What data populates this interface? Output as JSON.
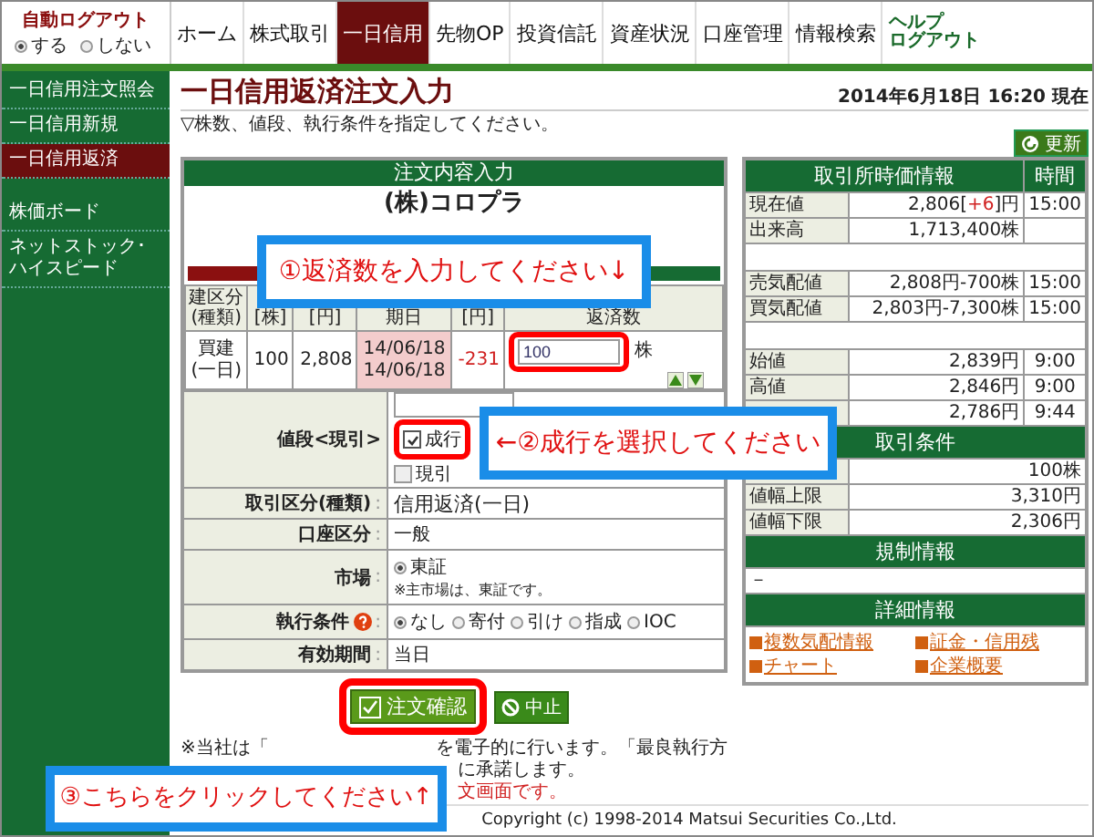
{
  "auto_logout": {
    "label": "自動ログアウト",
    "options": [
      {
        "label": "する",
        "selected": true
      },
      {
        "label": "しない",
        "selected": false
      }
    ]
  },
  "nav": [
    {
      "label": "ホーム",
      "selected": false
    },
    {
      "label": "株式取引",
      "selected": false
    },
    {
      "label": "一日信用",
      "selected": true
    },
    {
      "label": "先物OP",
      "selected": false
    },
    {
      "label": "投資信託",
      "selected": false
    },
    {
      "label": "資産状況",
      "selected": false
    },
    {
      "label": "口座管理",
      "selected": false
    },
    {
      "label": "情報検索",
      "selected": false
    }
  ],
  "header_links": [
    "ヘルプ",
    "ログアウト"
  ],
  "sidebar": [
    {
      "label": "一日信用注文照会",
      "selected": false
    },
    {
      "label": "一日信用新規",
      "selected": false
    },
    {
      "label": "一日信用返済",
      "selected": true
    },
    {
      "label": "株価ボード",
      "selected": false
    },
    {
      "label": "ネットストック･ハイスピード",
      "selected": false
    }
  ],
  "page": {
    "title": "一日信用返済注文入力",
    "timestamp": "2014年6月18日 16:20 現在",
    "instruction": "▽株数、値段、執行条件を指定してください。",
    "refresh": "更新"
  },
  "form": {
    "heading": "注文内容入力",
    "stock": "(株)コロプラ",
    "columns": [
      "建区分\n(種類)",
      "[株]",
      "[円]",
      "期日",
      "[円]",
      "返済数"
    ],
    "position": {
      "type": "買建\n(一日)",
      "shares": "100",
      "price": "2,808",
      "dates": "14/06/18\n14/06/18",
      "pl": "-231",
      "quantity": "100",
      "unit": "株"
    },
    "price": {
      "label": "値段<現引>",
      "options": [
        {
          "label": "成行",
          "checked": true
        },
        {
          "label": "現引",
          "checked": false
        }
      ]
    },
    "separator": ":",
    "rows": [
      {
        "kind": "text",
        "label": "取引区分(種類)",
        "value": "信用返済(一日)"
      },
      {
        "kind": "text",
        "label": "口座区分",
        "value": "一般"
      },
      {
        "kind": "radio",
        "label": "市場",
        "help": false,
        "options": [
          {
            "label": "東証",
            "selected": true
          }
        ],
        "note": "※主市場は、東証です。"
      },
      {
        "kind": "radio",
        "label": "執行条件",
        "help": true,
        "options": [
          {
            "label": "なし",
            "selected": true
          },
          {
            "label": "寄付",
            "selected": false
          },
          {
            "label": "引け",
            "selected": false
          },
          {
            "label": "指成",
            "selected": false
          },
          {
            "label": "IOC",
            "selected": false
          }
        ]
      },
      {
        "kind": "text",
        "label": "有効期間",
        "value": "当日"
      }
    ],
    "confirm": "注文確認",
    "cancel": "中止"
  },
  "notice": {
    "line_1": "※当社は「",
    "line_1_end": "を電子的に行います。「最良執行方",
    "line_2": "に承諾します。",
    "line_3": "文画面です。"
  },
  "copyright": "Copyright (c) 1998-2014 Matsui Securities Co.,Ltd.",
  "quote": {
    "heading": "取引所時価情報",
    "time_heading": "時間",
    "rows": [
      {
        "kind": "row",
        "label": "現在値",
        "value": "2,806[",
        "change": "+6",
        "unit": "]円",
        "time": "15:00"
      },
      {
        "kind": "row",
        "label": "出来高",
        "value": "1,713,400株"
      },
      {
        "kind": "blank"
      },
      {
        "kind": "row",
        "label": "売気配値",
        "value": "2,808円-700株",
        "time": "15:00"
      },
      {
        "kind": "row",
        "label": "買気配値",
        "value": "2,803円-7,300株",
        "time": "15:00"
      },
      {
        "kind": "blank"
      },
      {
        "kind": "row",
        "label": "始値",
        "value": "2,839円",
        "time": "9:00"
      },
      {
        "kind": "row",
        "label": "高値",
        "value": "2,846円",
        "time": "9:00"
      },
      {
        "kind": "row",
        "value": "2,786円",
        "time": "9:44"
      }
    ]
  },
  "conditions": {
    "heading": "取引条件",
    "rows": [
      {
        "value": "100株"
      },
      {
        "label": "値幅上限",
        "value": "3,310円"
      },
      {
        "label": "値幅下限",
        "value": "2,306円"
      }
    ]
  },
  "regulation": {
    "heading": "規制情報",
    "value": "－"
  },
  "details": {
    "heading": "詳細情報",
    "links": [
      "複数気配情報",
      "証金・信用残",
      "チャート",
      "企業概要"
    ]
  },
  "callouts": [
    "①返済数を入力してください↓",
    "←②成行を選択してください",
    "③こちらをクリックしてください↑"
  ]
}
